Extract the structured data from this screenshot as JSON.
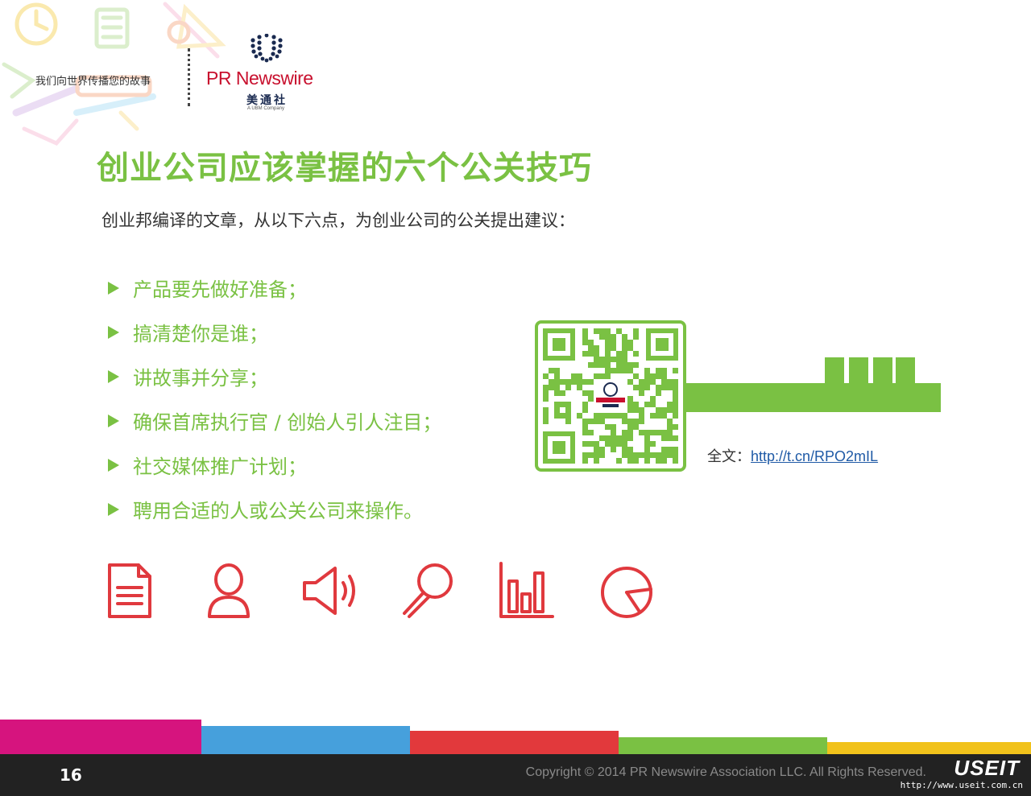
{
  "header": {
    "tagline": "我们向世界传播您的故事",
    "logo": {
      "brand": "PR Newswire",
      "cn_name": "美通社",
      "sub": "A UBM Company"
    }
  },
  "title": "创业公司应该掌握的六个公关技巧",
  "intro": "创业邦编译的文章，从以下六点，为创业公司的公关提出建议：",
  "tips": [
    "产品要先做好准备；",
    "搞清楚你是谁；",
    "讲故事并分享；",
    "确保首席执行官 / 创始人引人注目；",
    "社交媒体推广计划；",
    "聘用合适的人或公关公司来操作。"
  ],
  "fulltext": {
    "label": "全文：",
    "url": "http://t.cn/RPO2mIL"
  },
  "icons": [
    "document-icon",
    "person-icon",
    "speaker-icon",
    "magnifier-icon",
    "bar-chart-icon",
    "pie-chart-icon"
  ],
  "footer": {
    "page_number": "16",
    "copyright": "Copyright © 2014 PR Newswire Association LLC. All Rights Reserved.",
    "watermark_brand": "USEIT",
    "watermark_url": "http://www.useit.com.cn"
  },
  "colors": {
    "accent_green": "#7ac143",
    "icon_red": "#e0393e",
    "bar_magenta": "#d6147e",
    "bar_blue": "#46a0dc",
    "bar_red": "#e2393c",
    "bar_green": "#7ac143",
    "bar_yellow": "#f1c21b",
    "footer_dark": "#222222"
  }
}
